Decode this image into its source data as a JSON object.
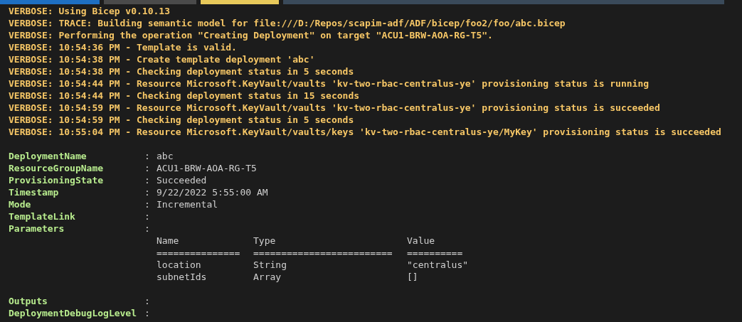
{
  "verbose_lines": [
    "VERBOSE: Using Bicep v0.10.13",
    "VERBOSE: TRACE: Building semantic model for file:///D:/Repos/scapim-adf/ADF/bicep/foo2/foo/abc.bicep",
    "VERBOSE: Performing the operation \"Creating Deployment\" on target \"ACU1-BRW-AOA-RG-T5\".",
    "VERBOSE: 10:54:36 PM - Template is valid.",
    "VERBOSE: 10:54:38 PM - Create template deployment 'abc'",
    "VERBOSE: 10:54:38 PM - Checking deployment status in 5 seconds",
    "VERBOSE: 10:54:44 PM - Resource Microsoft.KeyVault/vaults 'kv-two-rbac-centralus-ye' provisioning status is running",
    "VERBOSE: 10:54:44 PM - Checking deployment status in 15 seconds",
    "VERBOSE: 10:54:59 PM - Resource Microsoft.KeyVault/vaults 'kv-two-rbac-centralus-ye' provisioning status is succeeded",
    "VERBOSE: 10:54:59 PM - Checking deployment status in 5 seconds",
    "VERBOSE: 10:55:04 PM - Resource Microsoft.KeyVault/vaults/keys 'kv-two-rbac-centralus-ye/MyKey' provisioning status is succeeded"
  ],
  "properties": [
    {
      "name": "DeploymentName",
      "separator": ":",
      "value": "abc"
    },
    {
      "name": "ResourceGroupName",
      "separator": ":",
      "value": "ACU1-BRW-AOA-RG-T5"
    },
    {
      "name": "ProvisioningState",
      "separator": ":",
      "value": "Succeeded"
    },
    {
      "name": "Timestamp",
      "separator": ":",
      "value": "9/22/2022 5:55:00 AM"
    },
    {
      "name": "Mode",
      "separator": ":",
      "value": "Incremental"
    },
    {
      "name": "TemplateLink",
      "separator": ":"
    },
    {
      "name": "Parameters",
      "separator": ":",
      "table": {
        "columns": [
          {
            "label": "Name",
            "rule": "==============="
          },
          {
            "label": "Type",
            "rule": "========================="
          },
          {
            "label": "Value",
            "rule": "=========="
          }
        ],
        "rows": [
          [
            "location",
            "String",
            "\"centralus\""
          ],
          [
            "subnetIds",
            "Array",
            "[]"
          ]
        ]
      }
    },
    {
      "name": "Outputs",
      "separator": ":"
    },
    {
      "name": "DeploymentDebugLogLevel",
      "separator": ":"
    }
  ]
}
